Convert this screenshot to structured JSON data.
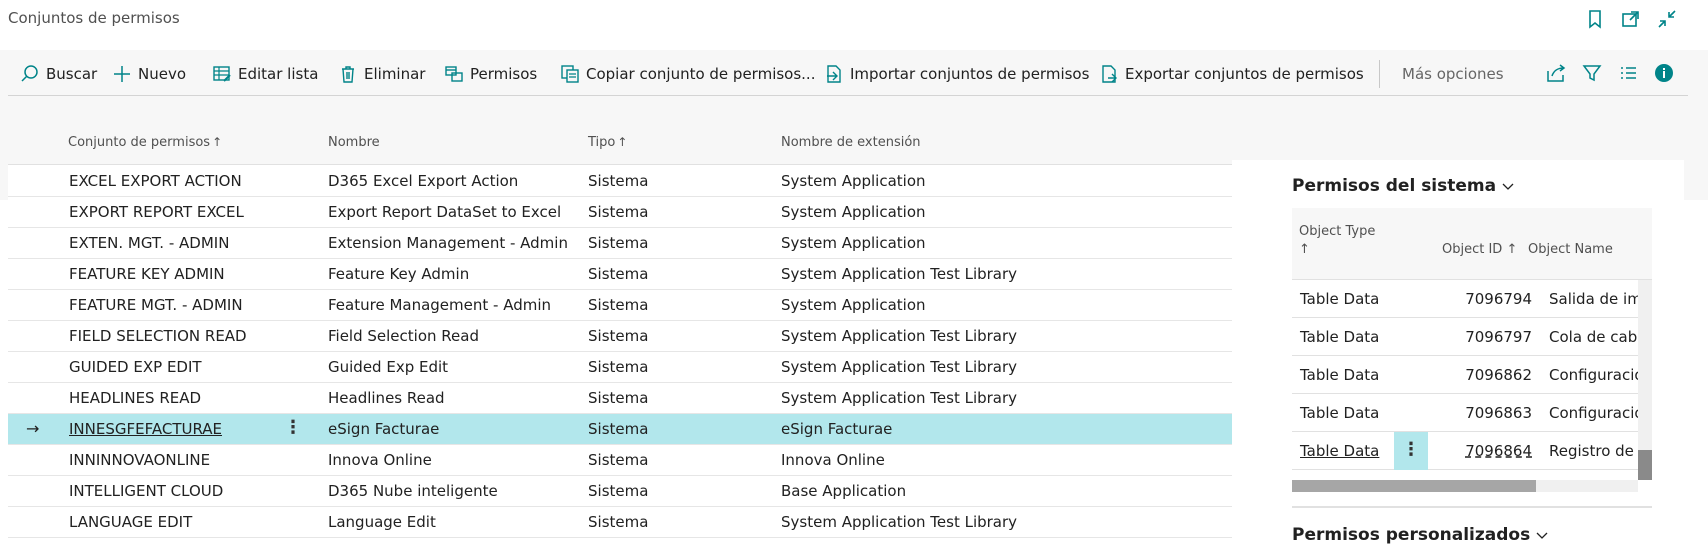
{
  "window": {
    "title": "Conjuntos de permisos"
  },
  "title_icons": [
    "bookmark-icon",
    "open-new-window-icon",
    "collapse-icon"
  ],
  "toolbar": {
    "buscar": "Buscar",
    "nuevo": "Nuevo",
    "editar_lista": "Editar lista",
    "eliminar": "Eliminar",
    "permisos": "Permisos",
    "copiar": "Copiar conjunto de permisos...",
    "importar": "Importar conjuntos de permisos",
    "exportar": "Exportar conjuntos de permisos",
    "mas_opciones": "Más opciones"
  },
  "list": {
    "columns": {
      "code": "Conjunto de permisos",
      "nombre": "Nombre",
      "tipo": "Tipo",
      "ext": "Nombre de extensión"
    },
    "sort_arrow": "↑",
    "selected_marker": "→",
    "row_menu": "⋮",
    "rows": [
      {
        "code": "EXCEL EXPORT ACTION",
        "nombre": "D365 Excel Export Action",
        "tipo": "Sistema",
        "ext": "System Application"
      },
      {
        "code": "EXPORT REPORT EXCEL",
        "nombre": "Export Report DataSet to Excel",
        "tipo": "Sistema",
        "ext": "System Application"
      },
      {
        "code": "EXTEN. MGT. - ADMIN",
        "nombre": "Extension Management - Admin",
        "tipo": "Sistema",
        "ext": "System Application"
      },
      {
        "code": "FEATURE KEY ADMIN",
        "nombre": "Feature Key Admin",
        "tipo": "Sistema",
        "ext": "System Application Test Library"
      },
      {
        "code": "FEATURE MGT. - ADMIN",
        "nombre": "Feature Management - Admin",
        "tipo": "Sistema",
        "ext": "System Application"
      },
      {
        "code": "FIELD SELECTION READ",
        "nombre": "Field Selection Read",
        "tipo": "Sistema",
        "ext": "System Application Test Library"
      },
      {
        "code": "GUIDED EXP EDIT",
        "nombre": "Guided Exp Edit",
        "tipo": "Sistema",
        "ext": "System Application Test Library"
      },
      {
        "code": "HEADLINES READ",
        "nombre": "Headlines Read",
        "tipo": "Sistema",
        "ext": "System Application Test Library"
      },
      {
        "code": "INNESGFEFACTURAE",
        "nombre": "eSign Facturae",
        "tipo": "Sistema",
        "ext": "eSign Facturae"
      },
      {
        "code": "INNINNOVAONLINE",
        "nombre": "Innova Online",
        "tipo": "Sistema",
        "ext": "Innova Online"
      },
      {
        "code": "INTELLIGENT CLOUD",
        "nombre": "D365 Nube inteligente",
        "tipo": "Sistema",
        "ext": "Base Application"
      },
      {
        "code": "LANGUAGE EDIT",
        "nombre": "Language Edit",
        "tipo": "Sistema",
        "ext": "System Application Test Library"
      }
    ]
  },
  "factbox": {
    "system_title": "Permisos del sistema",
    "custom_title": "Permisos personalizados",
    "columns": {
      "object_type": "Object Type",
      "object_id": "Object ID",
      "object_name": "Object Name"
    },
    "sort_arrow": "↑",
    "row_menu": "⋮",
    "rows": [
      {
        "type": "Table Data",
        "id": "7096794",
        "name": "Salida de imp"
      },
      {
        "type": "Table Data",
        "id": "7096797",
        "name": "Cola de cabe"
      },
      {
        "type": "Table Data",
        "id": "7096862",
        "name": "Configuració"
      },
      {
        "type": "Table Data",
        "id": "7096863",
        "name": "Configuració"
      },
      {
        "type": "Table Data",
        "id": "7096864",
        "name": "Registro de g"
      }
    ]
  },
  "colors": {
    "selected_row": "#b2e7ec",
    "accent": "#008489"
  }
}
